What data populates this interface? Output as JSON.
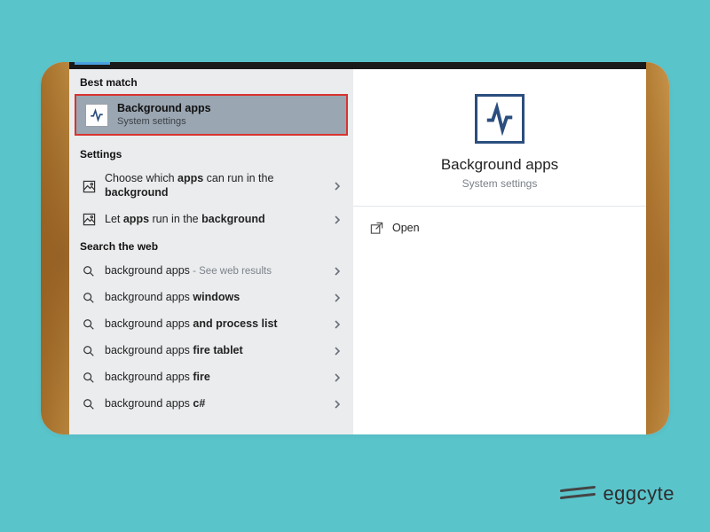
{
  "watermark": {
    "text": "eggcyte"
  },
  "left": {
    "section_best": "Best match",
    "best_item": {
      "title": "Background apps",
      "subtitle": "System settings"
    },
    "section_settings": "Settings",
    "settings": [
      {
        "html": "Choose which <b>apps</b> can run in the <b>background</b>"
      },
      {
        "html": "Let <b>apps</b> run in the <b>background</b>"
      }
    ],
    "section_web": "Search the web",
    "web": [
      {
        "html": "background apps",
        "suffix": " - See web results"
      },
      {
        "html": "background apps <b>windows</b>"
      },
      {
        "html": "background apps <b>and process list</b>"
      },
      {
        "html": "background apps <b>fire tablet</b>"
      },
      {
        "html": "background apps <b>fire</b>"
      },
      {
        "html": "background apps <b>c#</b>"
      }
    ]
  },
  "right": {
    "title": "Background apps",
    "subtitle": "System settings",
    "actions": [
      {
        "label": "Open"
      }
    ]
  }
}
